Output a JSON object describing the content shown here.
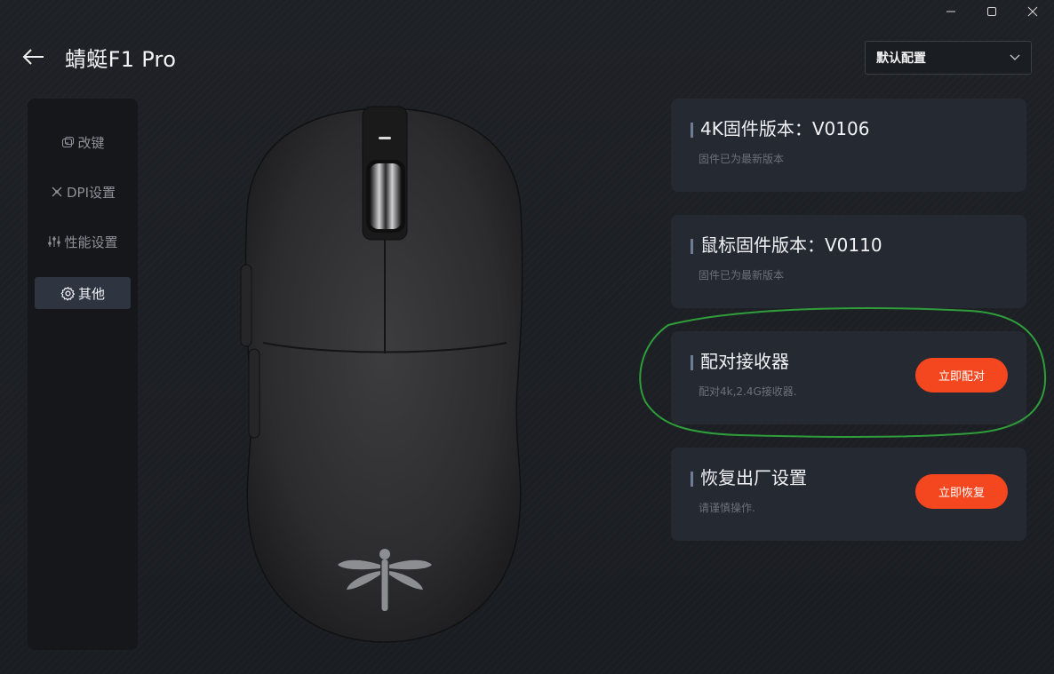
{
  "window": {
    "controls": [
      "minimize",
      "maximize",
      "close"
    ]
  },
  "header": {
    "title": "蜻蜓F1 Pro",
    "profile_select": {
      "selected": "默认配置"
    }
  },
  "sidebar": {
    "items": [
      {
        "label": "改键",
        "icon": "remap-icon",
        "active": false
      },
      {
        "label": "DPI设置",
        "icon": "dpi-icon",
        "active": false
      },
      {
        "label": "性能设置",
        "icon": "performance-icon",
        "active": false
      },
      {
        "label": "其他",
        "icon": "gear-icon",
        "active": true
      }
    ]
  },
  "cards": [
    {
      "title": "4K固件版本：V0106",
      "subtitle": "固件已为最新版本"
    },
    {
      "title": "鼠标固件版本：V0110",
      "subtitle": "固件已为最新版本"
    },
    {
      "title": "配对接收器",
      "subtitle": "配对4k,2.4G接收器.",
      "button": "立即配对"
    },
    {
      "title": "恢复出厂设置",
      "subtitle": "请谨慎操作.",
      "button": "立即恢复"
    }
  ],
  "colors": {
    "accent": "#f4471f",
    "card_bg": "#252931",
    "sidebar_bg": "#15171b",
    "annotation": "#2f9e3a"
  }
}
